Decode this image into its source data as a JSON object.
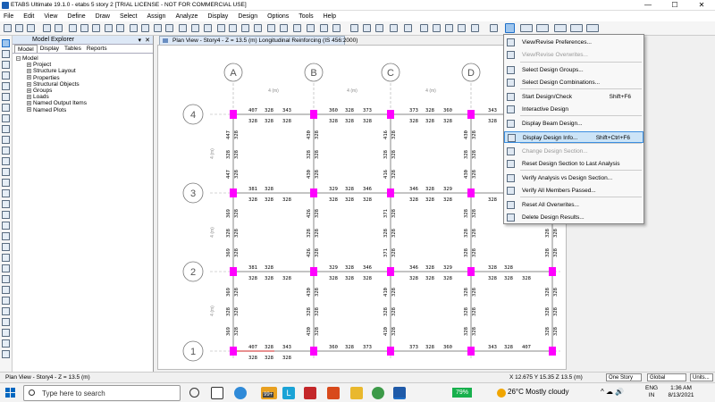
{
  "window": {
    "title": "ETABS Ultimate 19.1.0 - etabs 5 story 2  [TRIAL LICENSE - NOT FOR COMMERCIAL USE]"
  },
  "menu": [
    "File",
    "Edit",
    "View",
    "Define",
    "Draw",
    "Select",
    "Assign",
    "Analyze",
    "Display",
    "Design",
    "Options",
    "Tools",
    "Help"
  ],
  "explorer": {
    "title": "Model Explorer",
    "tabs": [
      "Model",
      "Display",
      "Tables",
      "Reports"
    ],
    "tree": [
      "Model",
      "Project",
      "Structure Layout",
      "Properties",
      "Structural Objects",
      "Groups",
      "Loads",
      "Named Output Items",
      "Named Plots"
    ]
  },
  "view": {
    "tab_title": "Plan View - Story4 - Z = 13.5 (m)  Longitudinal Reinforcing  (IS 456:2000)"
  },
  "grid": {
    "col_labels": [
      "A",
      "B",
      "C",
      "D"
    ],
    "row_labels": [
      "4",
      "3",
      "2",
      "1"
    ],
    "spacing_label": "4 (m)"
  },
  "beam_values": {
    "h_top": [
      [
        "407",
        "343",
        "360",
        "373",
        "373",
        "360",
        "343"
      ],
      [
        "328",
        "328",
        "328",
        "328",
        "328",
        "328",
        "328",
        "328",
        "328",
        "328",
        "328",
        "328"
      ]
    ],
    "h_row4": [
      "407",
      "328",
      "343",
      "360",
      "328",
      "373",
      "373",
      "328",
      "360",
      "343"
    ],
    "h_row3": [
      "381",
      "328",
      "329",
      "328",
      "346",
      "346",
      "328",
      "329"
    ],
    "h_row2": [
      "381",
      "328",
      "329",
      "328",
      "346",
      "346",
      "328",
      "329",
      "328",
      "328"
    ],
    "h_row1": [
      "407",
      "328",
      "343",
      "360",
      "328",
      "373",
      "373",
      "328",
      "360",
      "343",
      "328",
      "407"
    ],
    "bottom": "328",
    "v_col": [
      "447",
      "328",
      "328",
      "430",
      "328",
      "328",
      "416",
      "328",
      "328",
      "430",
      "328",
      "328"
    ],
    "v_mid": [
      "369",
      "328",
      "328",
      "426",
      "388",
      "328",
      "371",
      "328",
      "388",
      "328",
      "428"
    ],
    "v_low": [
      "369",
      "328",
      "328",
      "430",
      "388",
      "328",
      "410",
      "328",
      "430",
      "328",
      "369"
    ]
  },
  "dropdown": {
    "items": [
      {
        "label": "View/Revise Preferences...",
        "shortcut": "",
        "disabled": false
      },
      {
        "label": "View/Revise Overwrites...",
        "shortcut": "",
        "disabled": true
      },
      {
        "label": "Select Design Groups...",
        "shortcut": "",
        "disabled": false
      },
      {
        "label": "Select Design Combinations...",
        "shortcut": "",
        "disabled": false
      },
      {
        "label": "Start Design/Check",
        "shortcut": "Shift+F6",
        "disabled": false
      },
      {
        "label": "Interactive Design",
        "shortcut": "",
        "disabled": false
      },
      {
        "label": "Display Beam Design...",
        "shortcut": "",
        "disabled": false
      },
      {
        "label": "Display Design Info...",
        "shortcut": "Shift+Ctrl+F6",
        "disabled": false,
        "highlighted": true
      },
      {
        "label": "Change Design Section...",
        "shortcut": "",
        "disabled": true
      },
      {
        "label": "Reset Design Section to Last Analysis",
        "shortcut": "",
        "disabled": false
      },
      {
        "label": "Verify Analysis vs Design Section...",
        "shortcut": "",
        "disabled": false
      },
      {
        "label": "Verify All Members Passed...",
        "shortcut": "",
        "disabled": false
      },
      {
        "label": "Reset All Overwrites...",
        "shortcut": "",
        "disabled": false
      },
      {
        "label": "Delete Design Results...",
        "shortcut": "",
        "disabled": false
      }
    ]
  },
  "status": {
    "left": "Plan View - Story4 - Z = 13.5 (m)",
    "coords": "X 12.675  Y 15.35  Z 13.5 (m)",
    "story": "One Story",
    "coord_sys": "Global",
    "units": "Units..."
  },
  "taskbar": {
    "search_placeholder": "Type here to search",
    "battery": "79%",
    "weather": "26°C  Mostly cloudy",
    "lang": "ENG",
    "region": "IN",
    "time": "1:36 AM",
    "date": "8/13/2021",
    "badge": "99+"
  },
  "colors": {
    "column": "#ff00ff",
    "accent": "#1f6fc8",
    "grid": "#999999"
  }
}
